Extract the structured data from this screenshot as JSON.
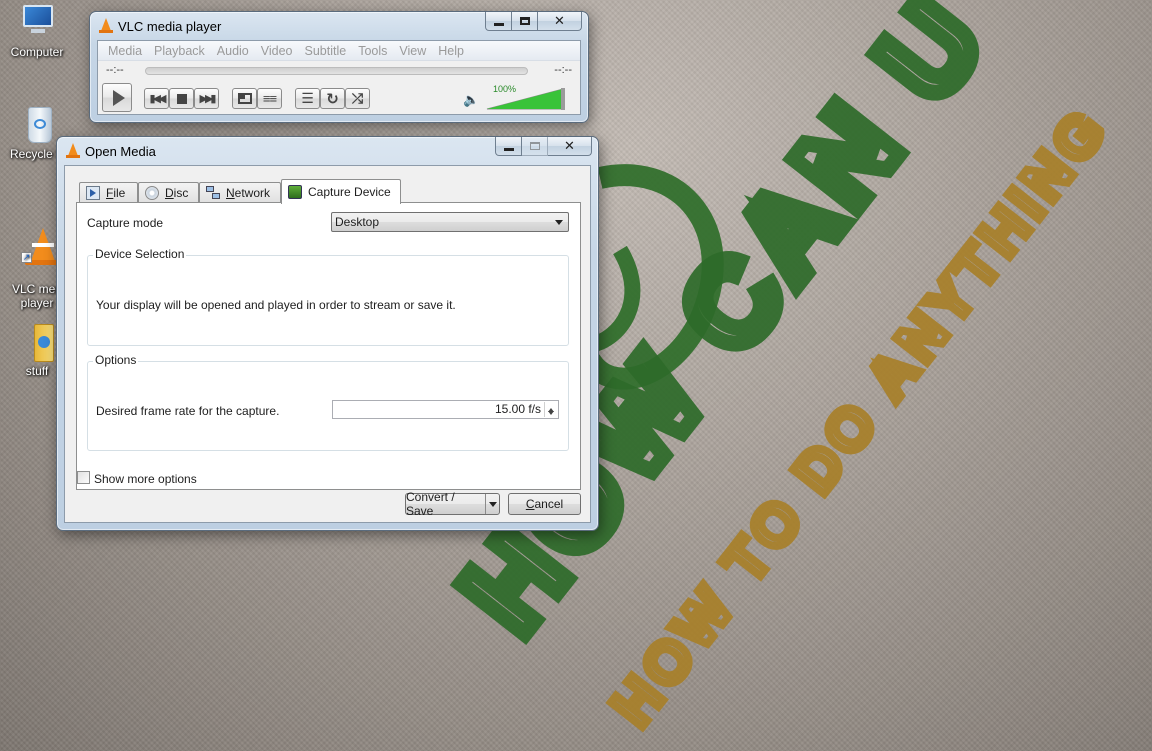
{
  "desktop": {
    "icons": [
      {
        "label": "Computer"
      },
      {
        "label": "Recycle B"
      },
      {
        "label": "VLC med\nplayer"
      },
      {
        "label": "stuff"
      }
    ],
    "wallpaper": {
      "brand": "HOW CAN U",
      "tagline": "HOW TO DO ANYTHING",
      "colors": {
        "green": "#2e6b2a",
        "gold": "#a8802a"
      }
    }
  },
  "vlc": {
    "title": "VLC media player",
    "menu": [
      "Media",
      "Playback",
      "Audio",
      "Video",
      "Subtitle",
      "Tools",
      "View",
      "Help"
    ],
    "time_elapsed": "--:--",
    "time_remaining": "--:--",
    "volume_label": "100%",
    "volume_level": 1.0,
    "icons": [
      "play-icon",
      "previous-icon",
      "stop-icon",
      "next-icon",
      "fullscreen-icon",
      "extended-settings-icon",
      "playlist-icon",
      "loop-icon",
      "shuffle-icon",
      "speaker-icon"
    ]
  },
  "dialog": {
    "title": "Open Media",
    "tabs": [
      {
        "label": "File",
        "icon": "file-icon"
      },
      {
        "label": "Disc",
        "icon": "disc-icon"
      },
      {
        "label": "Network",
        "icon": "network-icon"
      },
      {
        "label": "Capture Device",
        "icon": "capture-device-icon",
        "active": true
      }
    ],
    "capture_mode_label": "Capture mode",
    "capture_mode_value": "Desktop",
    "device_selection_title": "Device Selection",
    "device_selection_text": "Your display will be opened and played in order to stream or save it.",
    "options_title": "Options",
    "frame_rate_label": "Desired frame rate for the capture.",
    "frame_rate_value": "15.00 f/s",
    "show_more_label": "Show more options",
    "convert_label": "Convert / Save",
    "cancel_label": "Cancel"
  },
  "colors": {
    "vlc_orange": "#f28c1c",
    "volume_green": "#39c339",
    "window_frame": "#c6d6e6",
    "close_red": "#c75050"
  }
}
